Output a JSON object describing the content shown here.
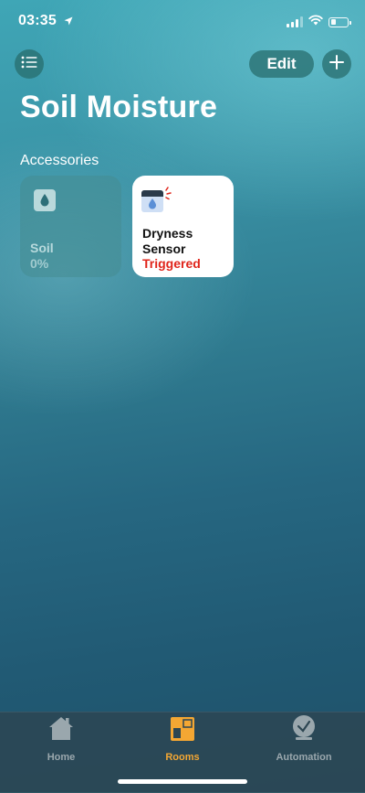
{
  "status_bar": {
    "time": "03:35",
    "battery_level": 0.3
  },
  "header": {
    "edit_label": "Edit",
    "page_title": "Soil Moisture",
    "section_title": "Accessories"
  },
  "accessories": [
    {
      "name": "Soil",
      "status": "0%",
      "icon": "water-drop-icon",
      "active": false
    },
    {
      "name": "Dryness\nSensor",
      "status": "Triggered",
      "icon": "leak-sensor-icon",
      "active": true,
      "status_color": "#e0251b"
    }
  ],
  "tab_bar": {
    "active_color": "#f4a733",
    "tabs": [
      {
        "label": "Home",
        "icon": "house-icon"
      },
      {
        "label": "Rooms",
        "icon": "rooms-icon"
      },
      {
        "label": "Automation",
        "icon": "clock-icon"
      }
    ]
  }
}
